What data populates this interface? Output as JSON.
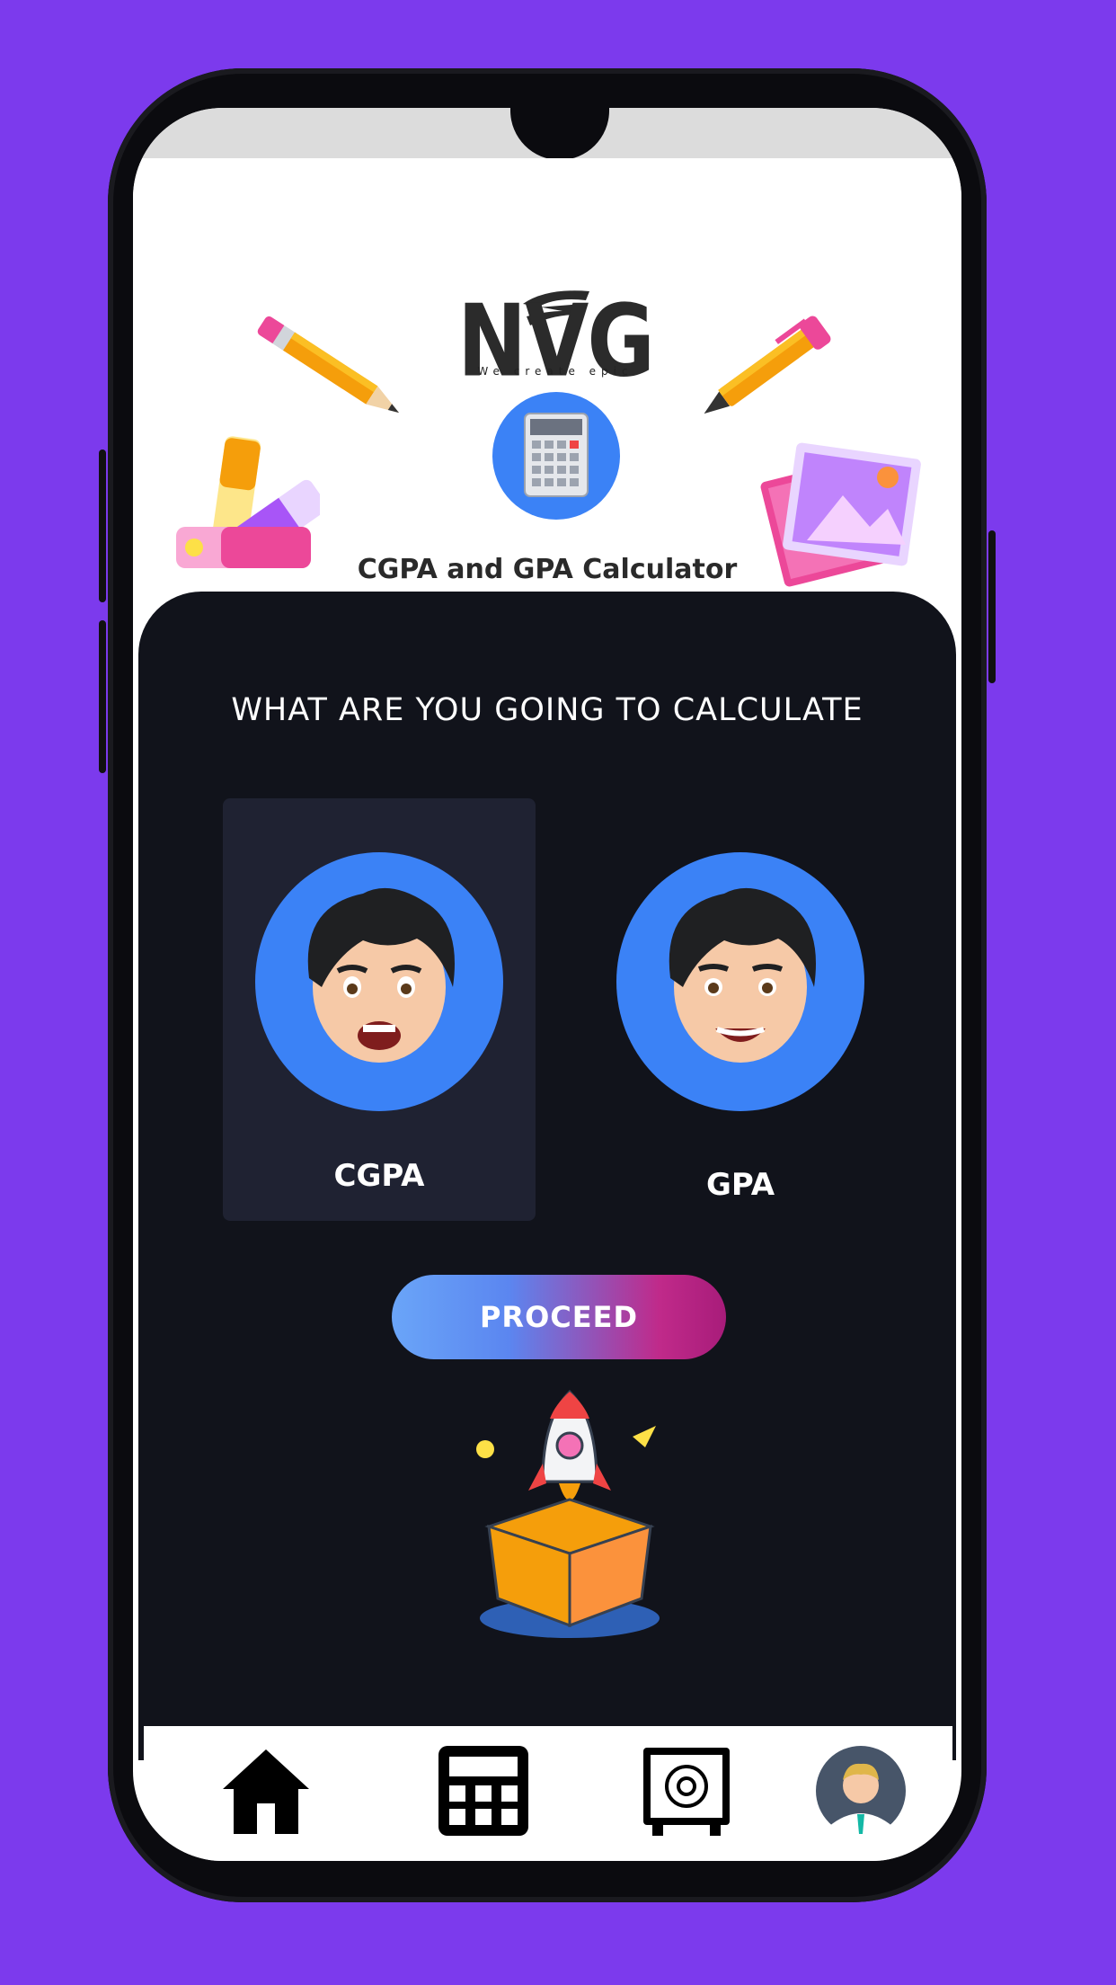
{
  "header": {
    "logo_text": "NVG",
    "logo_tagline": "We create epic",
    "app_title": "CGPA and GPA Calculator"
  },
  "main": {
    "question": "WHAT ARE YOU GOING TO CALCULATE",
    "options": [
      {
        "label": "CGPA",
        "selected": true
      },
      {
        "label": "GPA",
        "selected": false
      }
    ],
    "proceed_label": "PROCEED"
  },
  "bottom_nav": {
    "items": [
      {
        "icon": "home-icon"
      },
      {
        "icon": "calculator-icon"
      },
      {
        "icon": "safe-icon"
      },
      {
        "icon": "profile-avatar"
      }
    ]
  },
  "colors": {
    "background": "#7c3aed",
    "dark_panel": "#11131b",
    "accent_blue": "#3b82f6",
    "gradient_end": "#a81c7a"
  }
}
